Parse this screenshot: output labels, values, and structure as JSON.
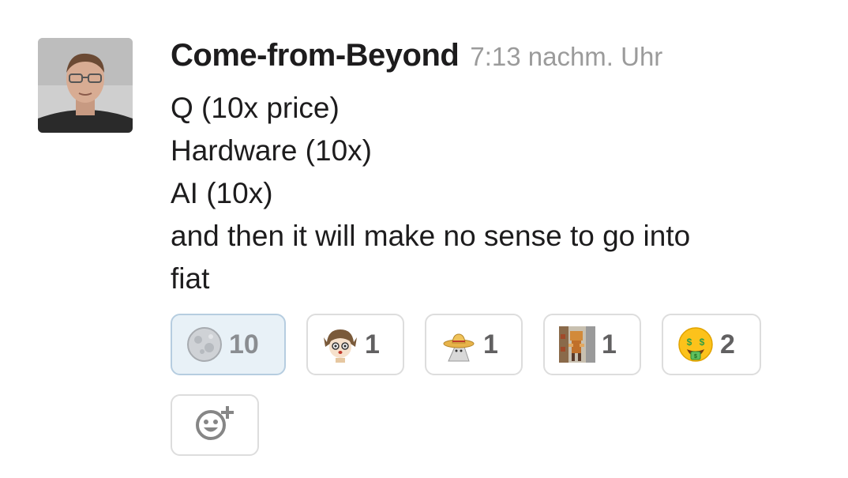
{
  "message": {
    "author": "Come-from-Beyond",
    "timestamp": "7:13 nachm. Uhr",
    "lines": [
      "Q (10x price)",
      "Hardware (10x)",
      "AI (10x)",
      "and then it will make no sense to go into",
      "fiat"
    ]
  },
  "reactions": [
    {
      "icon": "moon-emoji-icon",
      "count": "10",
      "active": true
    },
    {
      "icon": "anime-girl-emoji-icon",
      "count": "1",
      "active": false
    },
    {
      "icon": "sombrero-emoji-icon",
      "count": "1",
      "active": false
    },
    {
      "icon": "pixel-character-emoji-icon",
      "count": "1",
      "active": false
    },
    {
      "icon": "money-mouth-face-emoji-icon",
      "count": "2",
      "active": false
    }
  ],
  "add_reaction": {
    "icon": "add-reaction-icon"
  },
  "colors": {
    "text": "#1d1c1d",
    "timestamp": "#9b9b9b",
    "active_reaction_bg": "#e8f1f7",
    "active_reaction_border": "#b6cde0",
    "reaction_border": "#dddddd"
  }
}
